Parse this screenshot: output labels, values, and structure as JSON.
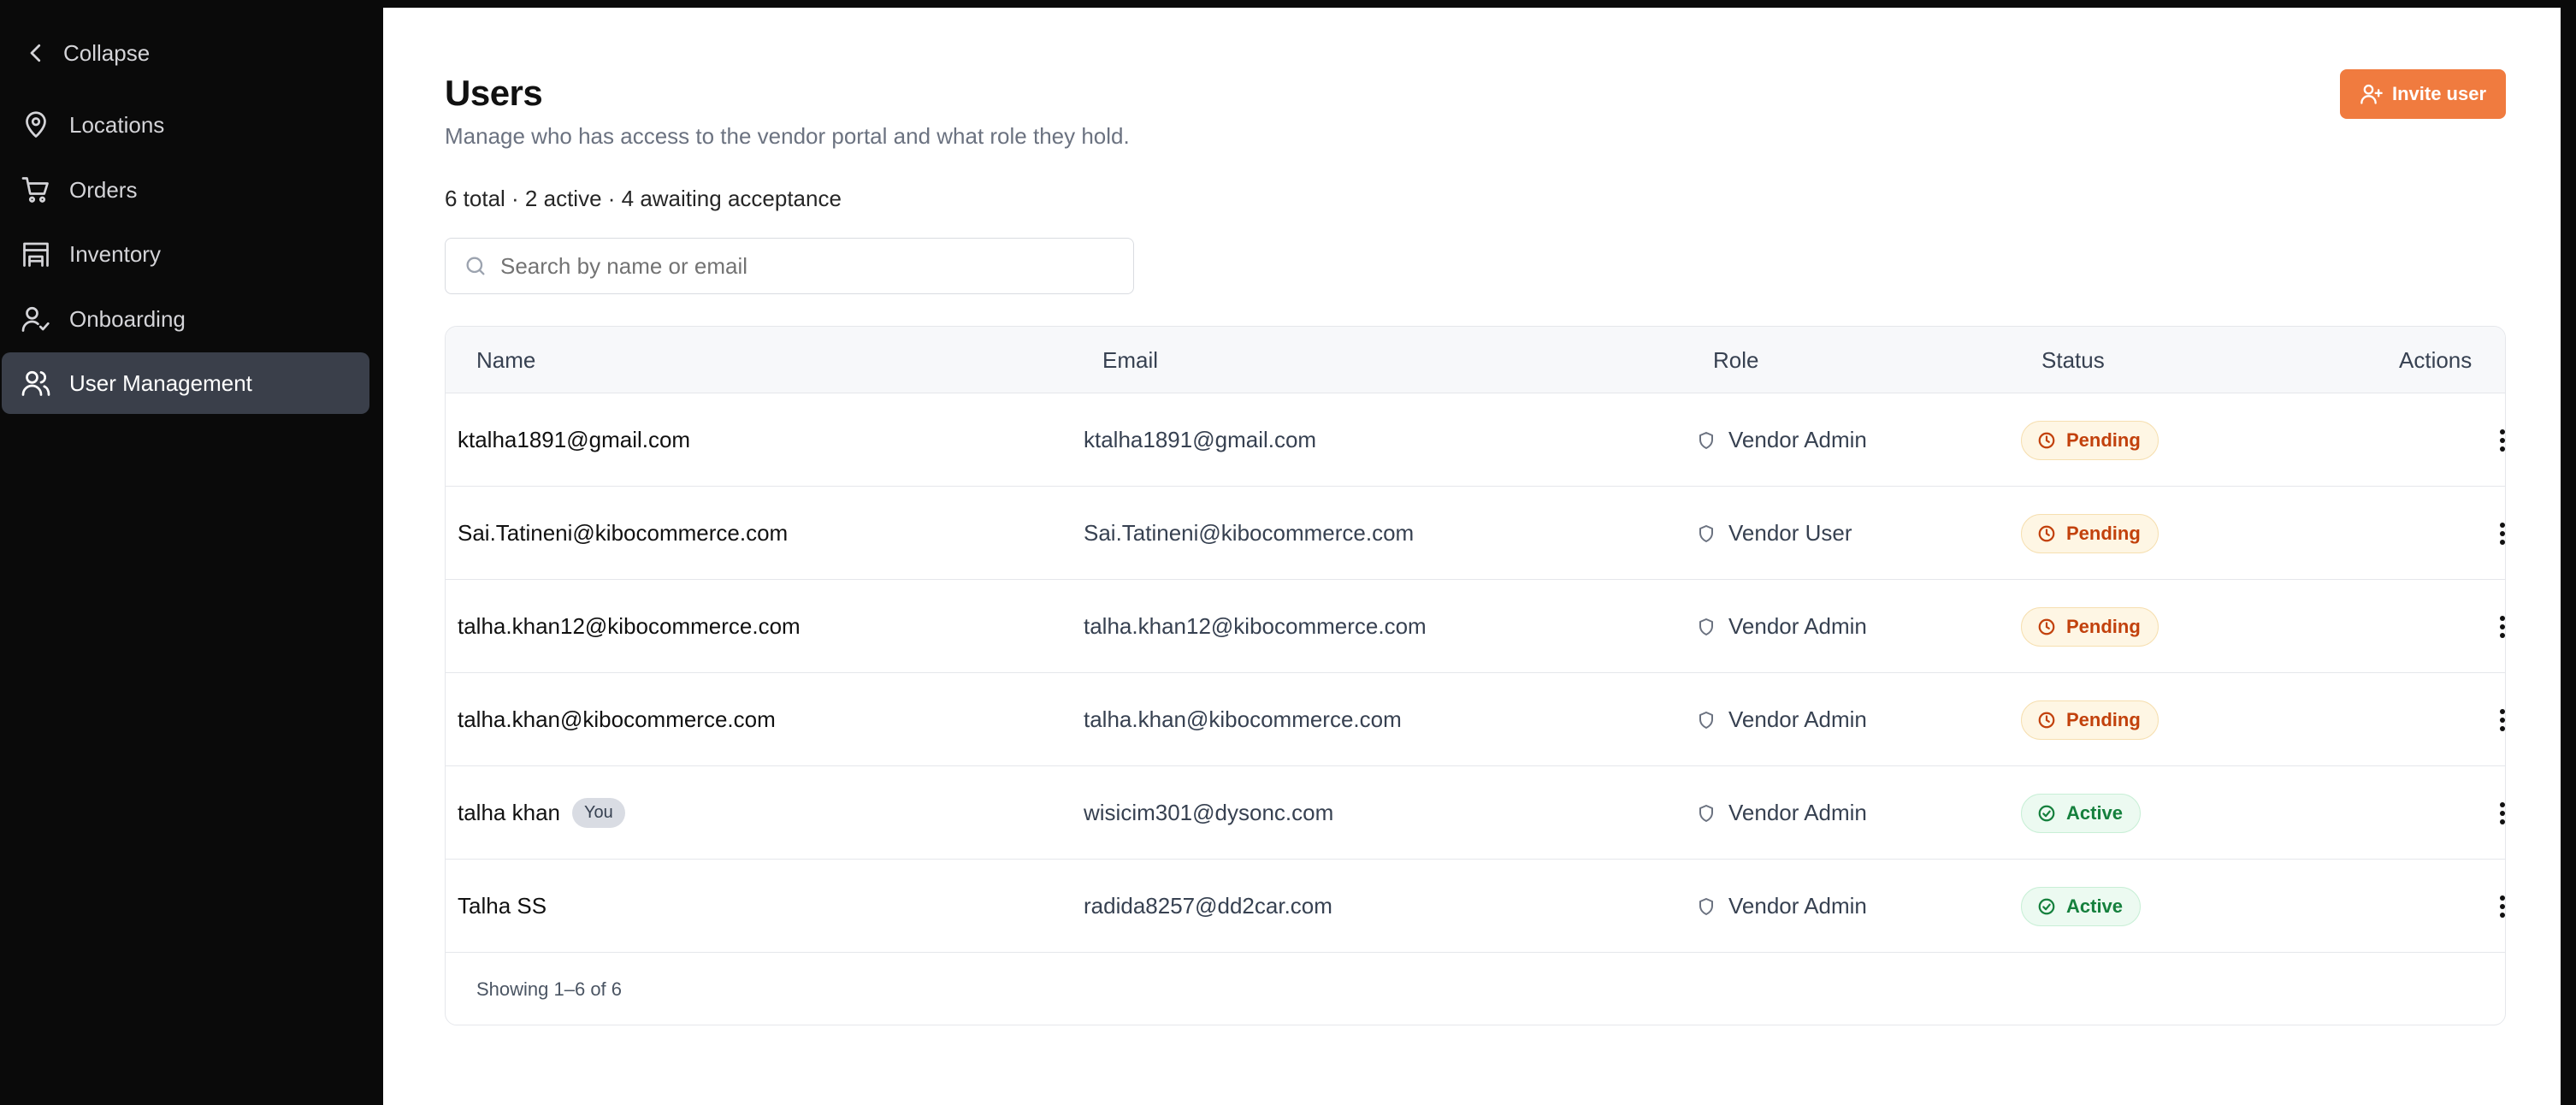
{
  "sidebar": {
    "collapse_label": "Collapse",
    "items": [
      {
        "label": "Locations",
        "icon": "map-pin-icon"
      },
      {
        "label": "Orders",
        "icon": "shopping-cart-icon"
      },
      {
        "label": "Inventory",
        "icon": "warehouse-icon"
      },
      {
        "label": "Onboarding",
        "icon": "user-check-icon"
      },
      {
        "label": "User Management",
        "icon": "users-icon",
        "active": true
      }
    ]
  },
  "header": {
    "title": "Users",
    "subtitle": "Manage who has access to the vendor portal and what role they hold.",
    "summary": "6 total · 2 active · 4 awaiting acceptance",
    "invite_label": "Invite user"
  },
  "search": {
    "placeholder": "Search by name or email",
    "value": ""
  },
  "table": {
    "columns": [
      "Name",
      "Email",
      "Role",
      "Status",
      "Actions"
    ],
    "rows": [
      {
        "name": "ktalha1891@gmail.com",
        "email": "ktalha1891@gmail.com",
        "role": "Vendor Admin",
        "status": "Pending"
      },
      {
        "name": "Sai.Tatineni@kibocommerce.com",
        "email": "Sai.Tatineni@kibocommerce.com",
        "role": "Vendor User",
        "status": "Pending"
      },
      {
        "name": "talha.khan12@kibocommerce.com",
        "email": "talha.khan12@kibocommerce.com",
        "role": "Vendor Admin",
        "status": "Pending"
      },
      {
        "name": "talha.khan@kibocommerce.com",
        "email": "talha.khan@kibocommerce.com",
        "role": "Vendor Admin",
        "status": "Pending"
      },
      {
        "name": "talha khan",
        "badge": "You",
        "email": "wisicim301@dysonc.com",
        "role": "Vendor Admin",
        "status": "Active"
      },
      {
        "name": "Talha SS",
        "email": "radida8257@dd2car.com",
        "role": "Vendor Admin",
        "status": "Active"
      }
    ],
    "footer": "Showing 1–6 of 6"
  },
  "colors": {
    "accent": "#f07b3f",
    "sidebar_bg": "#0a0a0a",
    "sidebar_active": "#3a3f4a",
    "pending": "#c2410c",
    "active": "#15803d"
  }
}
